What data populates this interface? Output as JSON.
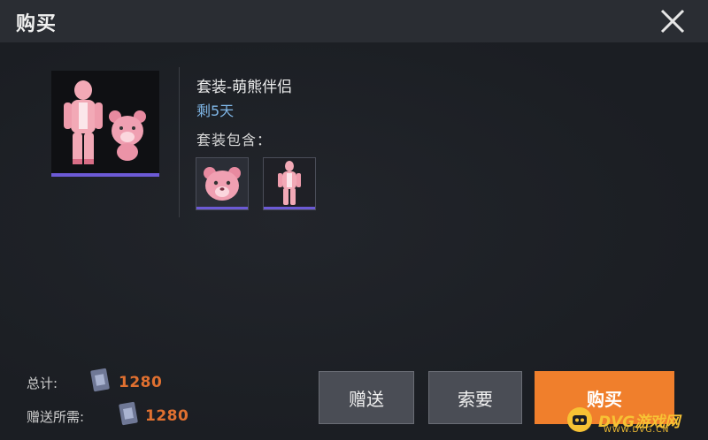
{
  "dialog": {
    "title": "购买",
    "close_icon": "close-icon"
  },
  "item": {
    "set_name": "套装-萌熊伴侣",
    "remaining": "剩5天",
    "includes_label": "套装包含：",
    "included_items": [
      {
        "name": "bear-head-icon"
      },
      {
        "name": "pink-suit-icon"
      }
    ],
    "accent_color": "#6c5ad6"
  },
  "cost": {
    "total_label": "总计:",
    "total_value": "1280",
    "gift_label": "赠送所需:",
    "gift_value": "1280",
    "currency_icon": "coupon-icon",
    "price_color": "#e07030"
  },
  "buttons": {
    "gift": "赠送",
    "ask": "索要",
    "buy": "购买",
    "buy_color": "#f07f2c"
  },
  "watermark": {
    "text": "DVG游戏网",
    "sub": "WWW.DVG.CN"
  }
}
